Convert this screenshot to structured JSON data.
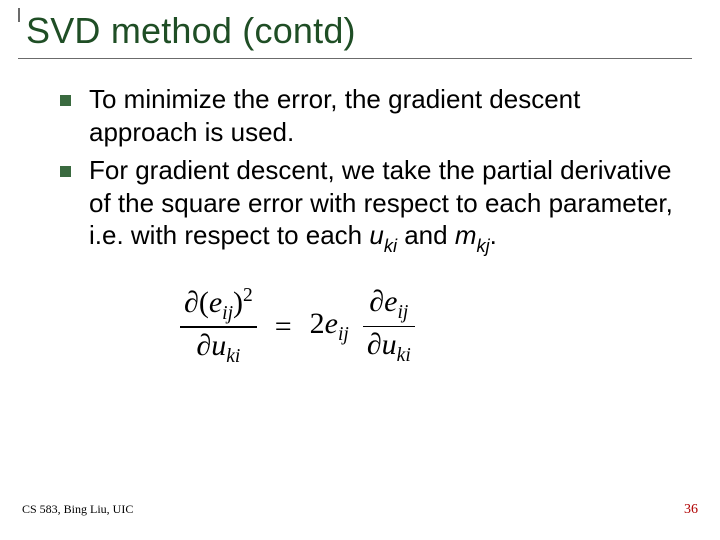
{
  "title": "SVD method (contd)",
  "bullets": [
    {
      "pre": "To minimize the error, the ",
      "em": "gradient descent",
      "post": " approach is used."
    },
    {
      "full": "For gradient descent, we take the partial derivative of the square error with respect to each parameter, i.e. with respect to each ",
      "var1": "u",
      "sub1": "ki",
      "mid": " and ",
      "var2": "m",
      "sub2": "kj",
      "end": "."
    }
  ],
  "equation": {
    "lhs_num_partial": "∂",
    "lhs_num_e": "e",
    "lhs_num_sub": "ij",
    "lhs_num_sup": "2",
    "lhs_den_partial": "∂",
    "lhs_den_u": "u",
    "lhs_den_sub": "ki",
    "eq": "=",
    "coeff2": "2",
    "coeff_e": "e",
    "coeff_sub": "ij",
    "rhs_num_partial": "∂",
    "rhs_num_e": "e",
    "rhs_num_sub": "ij",
    "rhs_den_partial": "∂",
    "rhs_den_u": "u",
    "rhs_den_sub": "ki"
  },
  "footer": {
    "left": "CS 583, Bing Liu, UIC",
    "right": "36"
  }
}
